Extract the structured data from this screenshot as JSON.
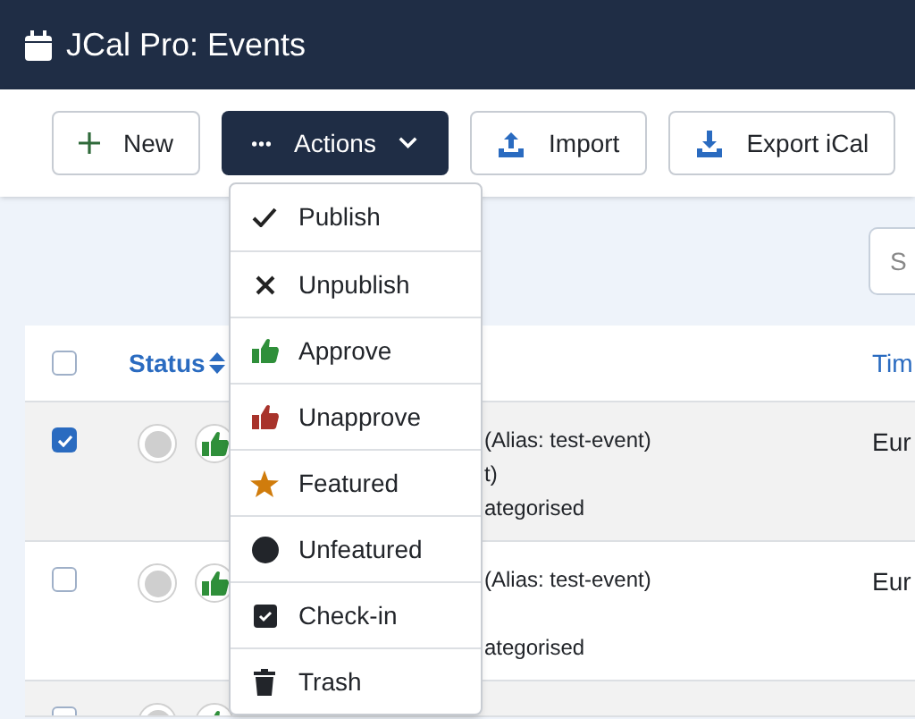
{
  "window": {
    "title": "JCal Pro: Events"
  },
  "toolbar": [
    {
      "label": "New",
      "kind": "new"
    },
    {
      "label": "Actions",
      "kind": "dropdown"
    },
    {
      "label": "Import",
      "kind": "import"
    },
    {
      "label": "Export iCal",
      "kind": "export"
    }
  ],
  "actions_menu": [
    {
      "label": "Publish",
      "kind": "check"
    },
    {
      "label": "Unpublish",
      "kind": "cross"
    },
    {
      "label": "Approve",
      "kind": "approve"
    },
    {
      "label": "Unapprove",
      "kind": "unapprove"
    },
    {
      "label": "Featured",
      "kind": "star"
    },
    {
      "label": "Unfeatured",
      "kind": "dot"
    },
    {
      "label": "Check-in",
      "kind": "checkin"
    },
    {
      "label": "Trash",
      "kind": "trash"
    }
  ],
  "search": {
    "placeholder": "S"
  },
  "table": {
    "columns": [
      "Status",
      "Tim"
    ],
    "select_all_checked": false,
    "rows": [
      {
        "selected": true,
        "lines": [
          "(Alias: test-event)",
          "t)",
          "ategorised"
        ],
        "timezone": "Eur"
      },
      {
        "selected": false,
        "lines": [
          "(Alias: test-event)",
          "ategorised"
        ],
        "timezone": "Eur"
      },
      {
        "selected": false
      }
    ]
  }
}
